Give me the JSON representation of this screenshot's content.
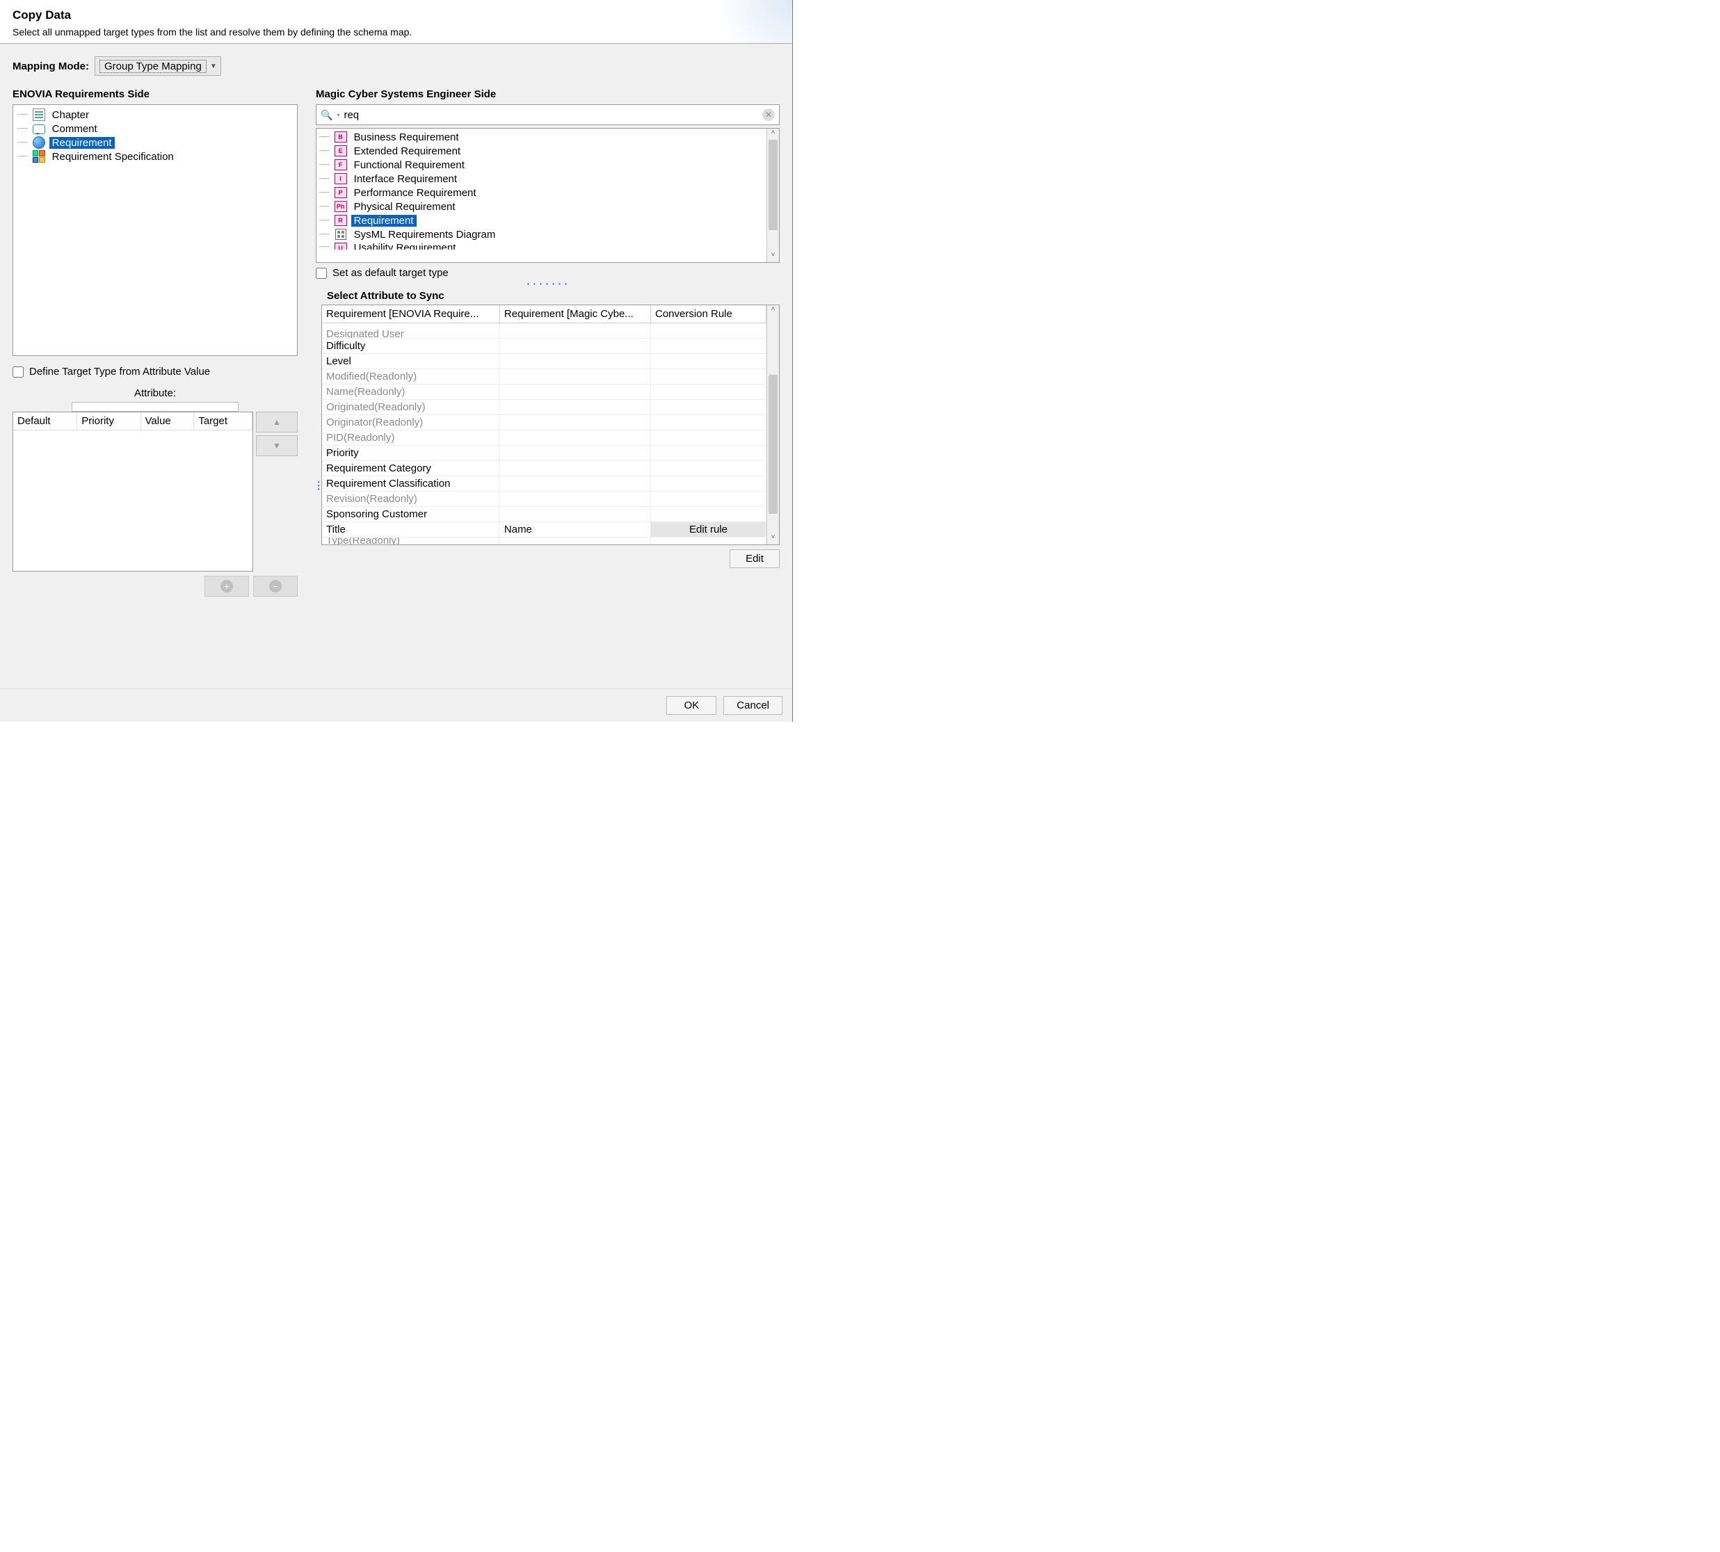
{
  "header": {
    "title": "Copy Data",
    "subtitle": "Select all unmapped target types from the list and resolve them by defining the schema map."
  },
  "mapping_mode": {
    "label": "Mapping Mode:",
    "value": "Group Type Mapping"
  },
  "left_panel": {
    "title": "ENOVIA Requirements Side",
    "items": [
      {
        "label": "Chapter",
        "selected": false,
        "icon": "chapter"
      },
      {
        "label": "Comment",
        "selected": false,
        "icon": "comment"
      },
      {
        "label": "Requirement",
        "selected": true,
        "icon": "req"
      },
      {
        "label": "Requirement Specification",
        "selected": false,
        "icon": "reqspec"
      }
    ],
    "define_target": {
      "label": "Define Target Type from Attribute Value",
      "checked": false
    },
    "attribute_label": "Attribute:",
    "attribute_value": "",
    "small_table_headers": [
      "Default",
      "Priority",
      "Value",
      "Target"
    ]
  },
  "right_panel": {
    "title": "Magic Cyber Systems Engineer Side",
    "search": {
      "value": "req"
    },
    "tree_items": [
      {
        "label": "Business Requirement",
        "selected": false,
        "badge": "B"
      },
      {
        "label": "Extended Requirement",
        "selected": false,
        "badge": "E"
      },
      {
        "label": "Functional Requirement",
        "selected": false,
        "badge": "F"
      },
      {
        "label": "Interface Requirement",
        "selected": false,
        "badge": "I"
      },
      {
        "label": "Performance Requirement",
        "selected": false,
        "badge": "P"
      },
      {
        "label": "Physical Requirement",
        "selected": false,
        "badge": "Ph"
      },
      {
        "label": "Requirement",
        "selected": true,
        "badge": "R"
      },
      {
        "label": "SysML Requirements Diagram",
        "selected": false,
        "badge": "diagram"
      },
      {
        "label": "Usability Requirement",
        "selected": false,
        "badge": "U",
        "cut": true
      }
    ],
    "set_default": {
      "label": "Set as default target type",
      "checked": false
    },
    "attr_section_title": "Select Attribute to Sync",
    "attr_headers": [
      "Requirement [ENOVIA Require...",
      "Requirement [Magic Cybe...",
      "Conversion Rule"
    ],
    "attr_rows": [
      {
        "c1": "Designated User",
        "readonly": false,
        "cutTop": true
      },
      {
        "c1": "Difficulty",
        "readonly": false
      },
      {
        "c1": "Level",
        "readonly": false
      },
      {
        "c1": "Modified(Readonly)",
        "readonly": true
      },
      {
        "c1": "Name(Readonly)",
        "readonly": true
      },
      {
        "c1": "Originated(Readonly)",
        "readonly": true
      },
      {
        "c1": "Originator(Readonly)",
        "readonly": true
      },
      {
        "c1": "PID(Readonly)",
        "readonly": true
      },
      {
        "c1": "Priority",
        "readonly": false
      },
      {
        "c1": "Requirement Category",
        "readonly": false
      },
      {
        "c1": "Requirement Classification",
        "readonly": false
      },
      {
        "c1": "Revision(Readonly)",
        "readonly": true
      },
      {
        "c1": "Sponsoring Customer",
        "readonly": false
      },
      {
        "c1": "Title",
        "readonly": false,
        "c2": "Name",
        "c3": "Edit rule",
        "edit": true
      },
      {
        "c1": "Type(Readonly)",
        "readonly": true,
        "cut": true
      }
    ],
    "edit_button": "Edit"
  },
  "footer": {
    "ok": "OK",
    "cancel": "Cancel"
  }
}
